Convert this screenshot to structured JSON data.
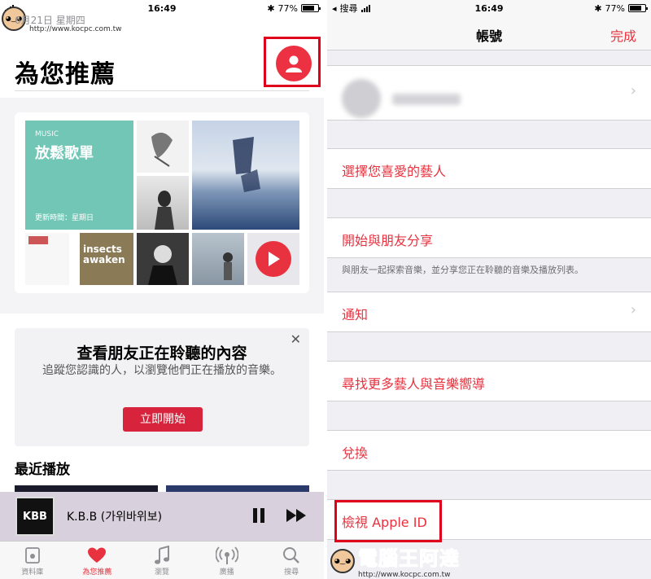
{
  "left": {
    "status": {
      "time": "16:49",
      "battery": "77%",
      "battery_level": 0.77
    },
    "date": "6月21日 星期四",
    "title": "為您推薦",
    "playlist": {
      "label": "MUSIC",
      "title": "放鬆歌單",
      "updated": "更新時間：星期日"
    },
    "album_text": "insects awaken",
    "friends": {
      "title": "查看朋友正在聆聽的內容",
      "description": "追蹤您認識的人，以瀏覽他們正在播放的音樂。",
      "button": "立即開始",
      "close": "✕"
    },
    "recent_title": "最近播放",
    "player": {
      "art_text": "KBB",
      "song": "K.B.B (가위바위보)"
    },
    "tabs": [
      {
        "label": "資料庫",
        "icon": "library-icon"
      },
      {
        "label": "為您推薦",
        "icon": "heart-icon"
      },
      {
        "label": "瀏覽",
        "icon": "music-note-icon"
      },
      {
        "label": "廣播",
        "icon": "radio-icon"
      },
      {
        "label": "搜尋",
        "icon": "search-icon"
      }
    ]
  },
  "right": {
    "status": {
      "back": "搜尋",
      "time": "16:49",
      "battery": "77%",
      "battery_level": 0.77
    },
    "nav": {
      "title": "帳號",
      "done": "完成"
    },
    "items": {
      "favorite_artists": "選擇您喜愛的藝人",
      "share": "開始與朋友分享",
      "share_note": "與朋友一起探索音樂，並分享您正在聆聽的音樂及播放列表。",
      "notifications": "通知",
      "find_more": "尋找更多藝人與音樂嚮導",
      "redeem": "兌換",
      "apple_id": "檢視 Apple ID"
    }
  },
  "watermark": {
    "text": "電腦王阿達",
    "url": "http://www.kocpc.com.tw"
  },
  "colors": {
    "accent": "#e8323f",
    "highlight": "#e0001b",
    "playlist": "#71c6b5"
  }
}
